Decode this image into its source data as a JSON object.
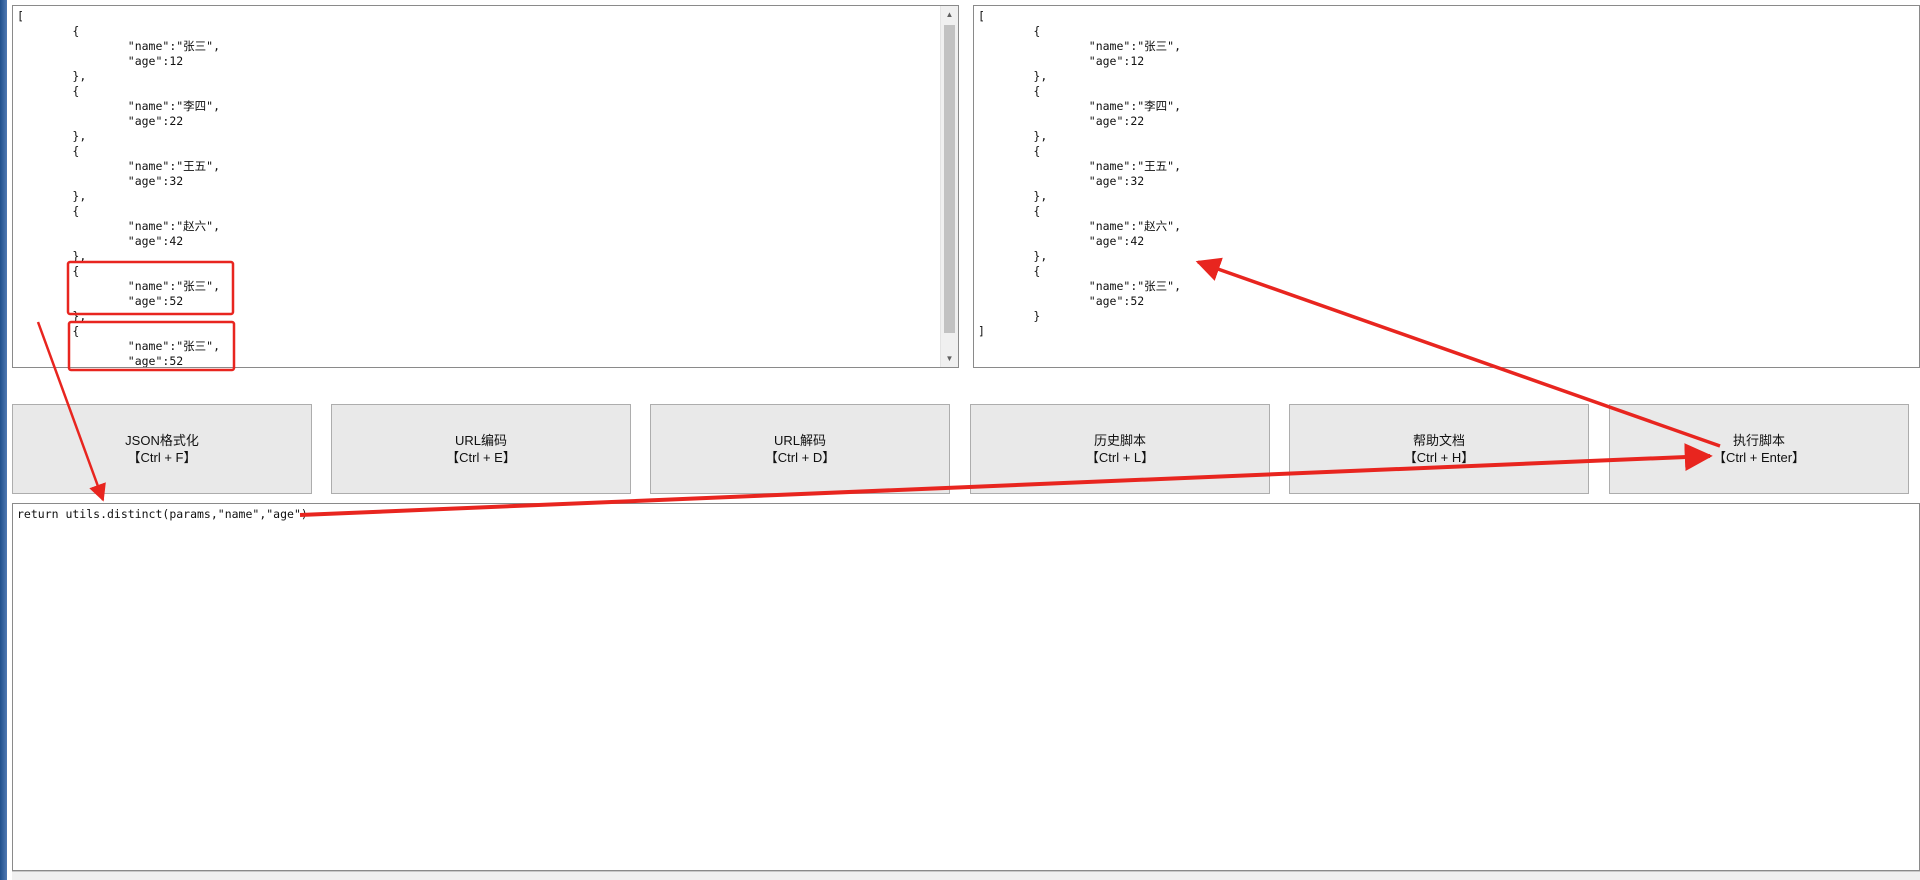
{
  "input": {
    "content": "[\n\t{\n\t\t\"name\":\"张三\",\n\t\t\"age\":12\n\t},\n\t{\n\t\t\"name\":\"李四\",\n\t\t\"age\":22\n\t},\n\t{\n\t\t\"name\":\"王五\",\n\t\t\"age\":32\n\t},\n\t{\n\t\t\"name\":\"赵六\",\n\t\t\"age\":42\n\t},\n\t{\n\t\t\"name\":\"张三\",\n\t\t\"age\":52\n\t},\n\t{\n\t\t\"name\":\"张三\",\n\t\t\"age\":52"
  },
  "output": {
    "content": "[\n\t{\n\t\t\"name\":\"张三\",\n\t\t\"age\":12\n\t},\n\t{\n\t\t\"name\":\"李四\",\n\t\t\"age\":22\n\t},\n\t{\n\t\t\"name\":\"王五\",\n\t\t\"age\":32\n\t},\n\t{\n\t\t\"name\":\"赵六\",\n\t\t\"age\":42\n\t},\n\t{\n\t\t\"name\":\"张三\",\n\t\t\"age\":52\n\t}\n]"
  },
  "toolbar": {
    "json_format": {
      "label": "JSON格式化",
      "shortcut": "【Ctrl + F】"
    },
    "url_encode": {
      "label": "URL编码",
      "shortcut": "【Ctrl + E】"
    },
    "url_decode": {
      "label": "URL解码",
      "shortcut": "【Ctrl + D】"
    },
    "history": {
      "label": "历史脚本",
      "shortcut": "【Ctrl + L】"
    },
    "help": {
      "label": "帮助文档",
      "shortcut": "【Ctrl + H】"
    },
    "run": {
      "label": "执行脚本",
      "shortcut": "【Ctrl + Enter】"
    }
  },
  "script": {
    "content": "return utils.distinct(params,\"name\",\"age\")"
  },
  "colors": {
    "annotation": "#e8251f",
    "window_edge": "#1f4f8b"
  },
  "icons": {
    "scroll_up": "up-arrow-icon",
    "scroll_down": "down-arrow-icon"
  }
}
